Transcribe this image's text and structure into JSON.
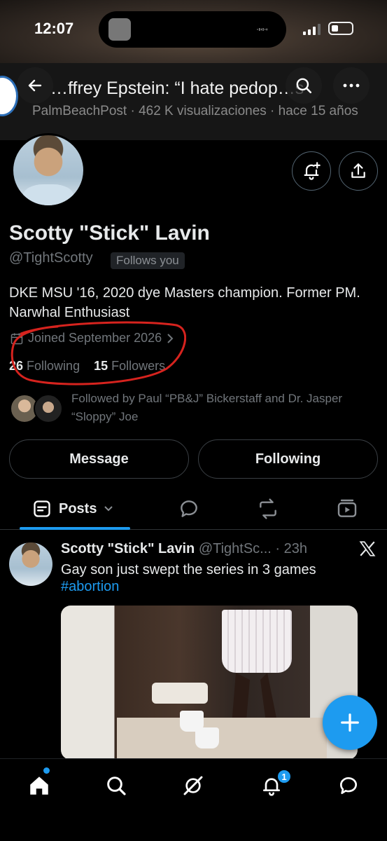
{
  "status_bar": {
    "time": "12:07"
  },
  "banner": {
    "headline": "…ffrey Epstein: “I hate pedop…s",
    "meta": "PalmBeachPost · 462 K visualizaciones · hace 15 años"
  },
  "nav": {
    "back_icon": "back-arrow-icon",
    "search_icon": "search-icon",
    "more_icon": "more-icon"
  },
  "profile": {
    "name": "Scotty \"Stick\" Lavin",
    "handle": "@TightScotty",
    "follows_you": "Follows you",
    "bio": "DKE MSU '16, 2020 dye Masters champion. Former PM. Narwhal Enthusiast",
    "joined": "Joined September 2026",
    "following_count": "26",
    "following_label": "Following",
    "followers_count": "15",
    "followers_label": "Followers",
    "followed_by": "Followed by Paul “PB&J” Bickerstaff and Dr. Jasper “Sloppy” Joe"
  },
  "actions": {
    "message": "Message",
    "following": "Following"
  },
  "tabs": {
    "posts": "Posts"
  },
  "tweet": {
    "author_name": "Scotty \"Stick\" Lavin",
    "author_handle": "@TightSc...",
    "time": "· 23h",
    "text": "Gay son just swept the series in 3 games",
    "hashtag": "#abortion"
  },
  "bottom_nav": {
    "notifications_badge": "1"
  },
  "colors": {
    "accent": "#1d9bf0",
    "background": "#000000",
    "annotation_red": "#d6231e"
  }
}
